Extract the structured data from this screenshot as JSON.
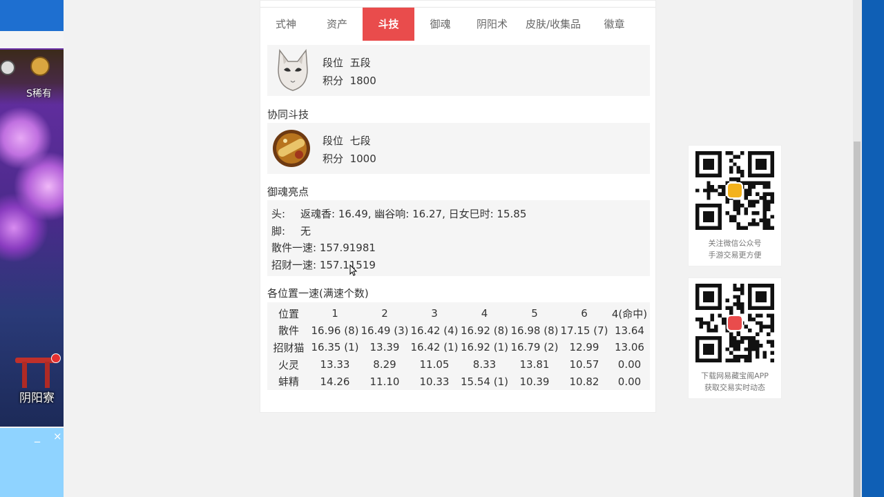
{
  "game_window": {
    "rarity_label": "S稀有",
    "building_label": "阴阳寮",
    "minimize_glyph": "_",
    "close_glyph": "×"
  },
  "tabs": [
    {
      "label": "式神",
      "active": false
    },
    {
      "label": "资产",
      "active": false
    },
    {
      "label": "斗技",
      "active": true
    },
    {
      "label": "御魂",
      "active": false
    },
    {
      "label": "阴阳术",
      "active": false
    },
    {
      "label": "皮肤/收集品",
      "active": false
    },
    {
      "label": "徽章",
      "active": false
    }
  ],
  "pvp": {
    "rank_label": "段位",
    "rank_value": "五段",
    "score_label": "积分",
    "score_value": "1800",
    "icon": "fox-mask-icon"
  },
  "coop_pvp": {
    "title": "协同斗技",
    "rank_label": "段位",
    "rank_value": "七段",
    "score_label": "积分",
    "score_value": "1000",
    "icon": "bell-drum-icon"
  },
  "soul_highlights": {
    "title": "御魂亮点",
    "head_label": "头:",
    "head_value": "返魂香: 16.49, 幽谷响: 16.27, 日女巳时: 15.85",
    "foot_label": "脚:",
    "foot_value": "无",
    "scatter_speed": "散件一速: 157.91981",
    "zhaocai_speed": "招财一速: 157.11519"
  },
  "speed_table": {
    "title": "各位置一速(满速个数)",
    "headers": [
      "位置",
      "1",
      "2",
      "3",
      "4",
      "5",
      "6",
      "4(命中)"
    ],
    "rows": [
      [
        "散件",
        "16.96 (8)",
        "16.49 (3)",
        "16.42 (4)",
        "16.92 (8)",
        "16.98 (8)",
        "17.15 (7)",
        "13.64"
      ],
      [
        "招财猫",
        "16.35 (1)",
        "13.39",
        "16.42 (1)",
        "16.92 (1)",
        "16.79 (2)",
        "12.99",
        "13.06"
      ],
      [
        "火灵",
        "13.33",
        "8.29",
        "11.05",
        "8.33",
        "13.81",
        "10.57",
        "0.00"
      ],
      [
        "蚌精",
        "14.26",
        "11.10",
        "10.33",
        "15.54 (1)",
        "10.39",
        "10.82",
        "0.00"
      ]
    ]
  },
  "qr_wechat": {
    "line1": "关注微信公众号",
    "line2": "手游交易更方便",
    "icon": "wechat-qr-code"
  },
  "qr_app": {
    "line1": "下载网易藏宝阁APP",
    "line2": "获取交易实时动态",
    "icon": "app-qr-code"
  },
  "colors": {
    "accent": "#e94c4c",
    "panel_bg": "#f5f5f5",
    "page_bg": "#f2f2f2"
  }
}
